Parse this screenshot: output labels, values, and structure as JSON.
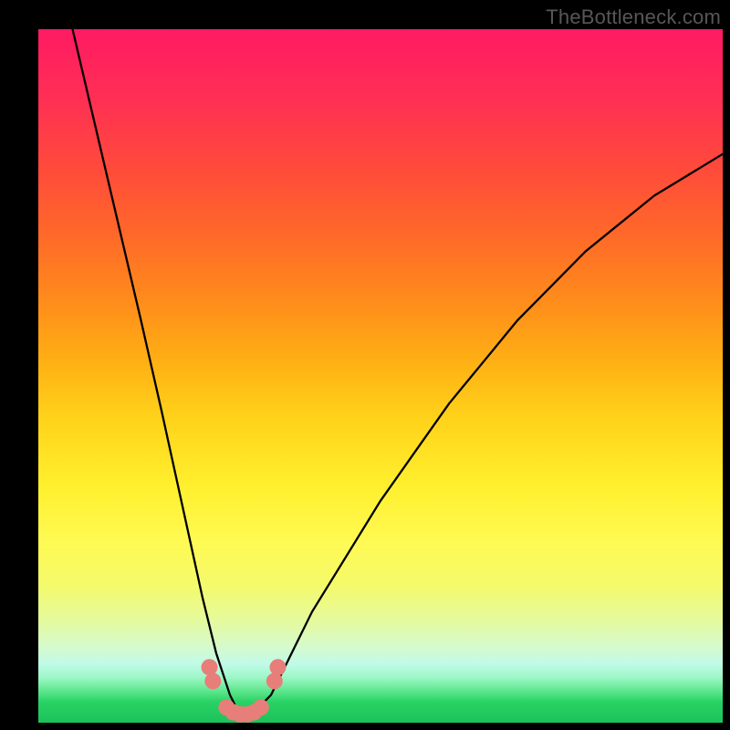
{
  "watermark": "TheBottleneck.com",
  "colors": {
    "background": "#000000",
    "gradient_top": "#ff1a63",
    "gradient_mid": "#fff02e",
    "gradient_bottom": "#1cc25a",
    "curve": "#000000",
    "markers": "#e77e7a"
  },
  "chart_data": {
    "type": "line",
    "title": "",
    "xlabel": "",
    "ylabel": "",
    "xlim": [
      0,
      100
    ],
    "ylim": [
      0,
      100
    ],
    "annotations": [],
    "series": [
      {
        "name": "bottleneck-curve",
        "x": [
          5,
          10,
          15,
          18,
          20,
          22,
          24,
          26,
          28,
          29,
          30,
          31,
          32,
          34,
          36,
          40,
          45,
          50,
          55,
          60,
          65,
          70,
          75,
          80,
          85,
          90,
          95,
          100
        ],
        "values": [
          100,
          79,
          58,
          45,
          36,
          27,
          18,
          10,
          4,
          2,
          1,
          1,
          2,
          4,
          8,
          16,
          24,
          32,
          39,
          46,
          52,
          58,
          63,
          68,
          72,
          76,
          79,
          82
        ]
      }
    ],
    "markers": [
      {
        "x": 25.0,
        "y": 8.0
      },
      {
        "x": 25.5,
        "y": 6.0
      },
      {
        "x": 27.5,
        "y": 2.2
      },
      {
        "x": 28.5,
        "y": 1.5
      },
      {
        "x": 29.5,
        "y": 1.2
      },
      {
        "x": 30.5,
        "y": 1.2
      },
      {
        "x": 31.5,
        "y": 1.5
      },
      {
        "x": 32.5,
        "y": 2.2
      },
      {
        "x": 34.5,
        "y": 6.0
      },
      {
        "x": 35.0,
        "y": 8.0
      }
    ]
  }
}
